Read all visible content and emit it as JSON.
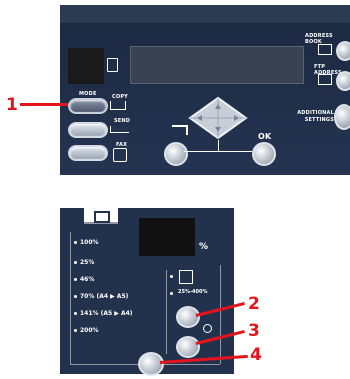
{
  "top_panel": {
    "mode_label": "MODE",
    "copy_label": "COPY",
    "send_label": "SEND",
    "fax_label": "FAX",
    "address_book_label": "ADDRESS BOOK",
    "ftp_address_label": "FTP ADDRESS",
    "additional_settings_label": "ADDITIONAL SETTINGS",
    "ok_label": "OK"
  },
  "bottom_panel": {
    "percent_sign": "%",
    "zoom_options": [
      "100%",
      "25%",
      "46%",
      "70% (A4 ▶ A5)",
      "141% (A5 ▶ A4)",
      "200%"
    ],
    "range_label": "25%-400%"
  },
  "callouts": {
    "one": "1",
    "two": "2",
    "three": "3",
    "four": "4"
  },
  "colors": {
    "panel": "#23324c",
    "callout": "#e3141c",
    "button_light": "#c7ced8"
  }
}
